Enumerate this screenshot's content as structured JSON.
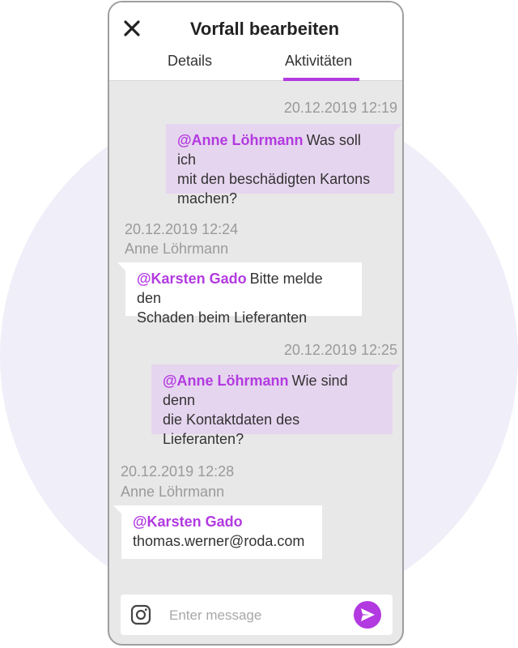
{
  "header": {
    "title": "Vorfall bearbeiten",
    "close_icon": "close-icon",
    "tabs": [
      {
        "label": "Details",
        "active": false
      },
      {
        "label": "Aktivitäten",
        "active": true
      }
    ]
  },
  "colors": {
    "accent": "#b23ae0",
    "outgoing_bubble": "#e6d5ef",
    "incoming_bubble": "#ffffff",
    "chat_background": "#e8e8e8",
    "backdrop_circle": "#f0eef8"
  },
  "messages": [
    {
      "direction": "outgoing",
      "timestamp": "20.12.2019 12:19",
      "mention": "@Anne Löhrmann",
      "line1_rest": "Was soll ich",
      "line2": "mit den beschädigten Kartons",
      "line3": "machen?"
    },
    {
      "direction": "incoming",
      "timestamp": "20.12.2019 12:24",
      "author": "Anne Löhrmann",
      "mention": "@Karsten Gado",
      "line1_rest": "Bitte melde den",
      "line2": "Schaden beim Lieferanten"
    },
    {
      "direction": "outgoing",
      "timestamp": "20.12.2019 12:25",
      "mention": "@Anne Löhrmann",
      "line1_rest": "Wie sind denn",
      "line2": "die Kontaktdaten des",
      "line3": "Lieferanten?"
    },
    {
      "direction": "incoming",
      "timestamp": "20.12.2019 12:28",
      "author": "Anne Löhrmann",
      "mention": "@Karsten Gado",
      "line2": "thomas.werner@roda.com"
    }
  ],
  "composer": {
    "placeholder": "Enter message",
    "value": "",
    "attach_icon": "instagram-icon",
    "send_icon": "send-icon"
  }
}
